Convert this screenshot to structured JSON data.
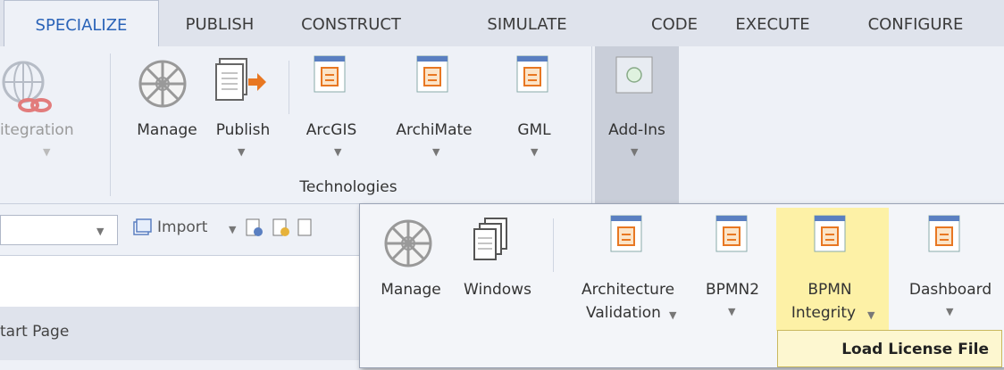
{
  "tabs": [
    {
      "label": "SPECIALIZE"
    },
    {
      "label": "PUBLISH"
    },
    {
      "label": "CONSTRUCT"
    },
    {
      "label": "SIMULATE"
    },
    {
      "label": "CODE"
    },
    {
      "label": "EXECUTE"
    },
    {
      "label": "CONFIGURE"
    }
  ],
  "ribbon": {
    "integration": "itegration",
    "manage": "Manage",
    "publish": "Publish",
    "arcgis": "ArcGIS",
    "archimate": "ArchiMate",
    "gml": "GML",
    "addins": "Add-Ins",
    "group_technologies": "Technologies"
  },
  "toolbar": {
    "import_label": "Import"
  },
  "start_page": "tart Page",
  "popup": {
    "manage": "Manage",
    "windows": "Windows",
    "architecture_line1": "Architecture",
    "architecture_line2": "Validation",
    "bpmn2": "BPMN2",
    "bpmn_integrity_line1": "BPMN",
    "bpmn_integrity_line2": "Integrity",
    "dashboard": "Dashboard"
  },
  "menu": {
    "load_license": "Load License File"
  },
  "colors": {
    "accent": "#2a63b8",
    "highlight": "#fdf1a6",
    "ribbon_bg": "#eef1f7"
  }
}
